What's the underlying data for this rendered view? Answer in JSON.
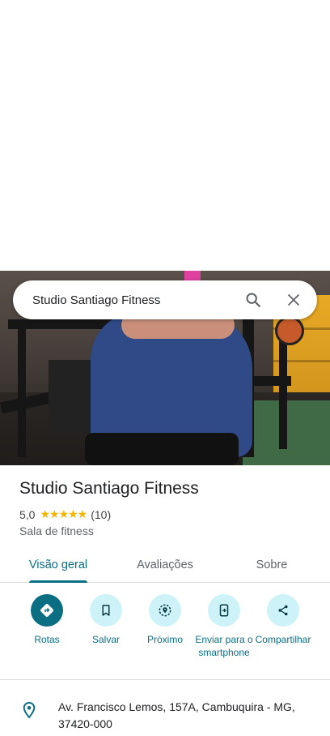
{
  "search": {
    "query": "Studio Santiago Fitness"
  },
  "place": {
    "name": "Studio Santiago Fitness",
    "rating": "5,0",
    "stars": "★★★★★",
    "reviews_count": "(10)",
    "category": "Sala de fitness",
    "address": "Av. Francisco Lemos, 157A, Cambuquira - MG, 37420-000"
  },
  "tabs": [
    {
      "label": "Visão geral",
      "active": true
    },
    {
      "label": "Avaliações",
      "active": false
    },
    {
      "label": "Sobre",
      "active": false
    }
  ],
  "actions": [
    {
      "label": "Rotas",
      "icon": "directions-icon"
    },
    {
      "label": "Salvar",
      "icon": "bookmark-icon"
    },
    {
      "label": "Próximo",
      "icon": "nearby-icon"
    },
    {
      "label": "Enviar para o smartphone",
      "icon": "send-to-phone-icon"
    },
    {
      "label": "Compartilhar",
      "icon": "share-icon"
    }
  ],
  "colors": {
    "accent": "#0b6e83",
    "action_bg": "#cdf3f9",
    "star": "#f5b400"
  }
}
